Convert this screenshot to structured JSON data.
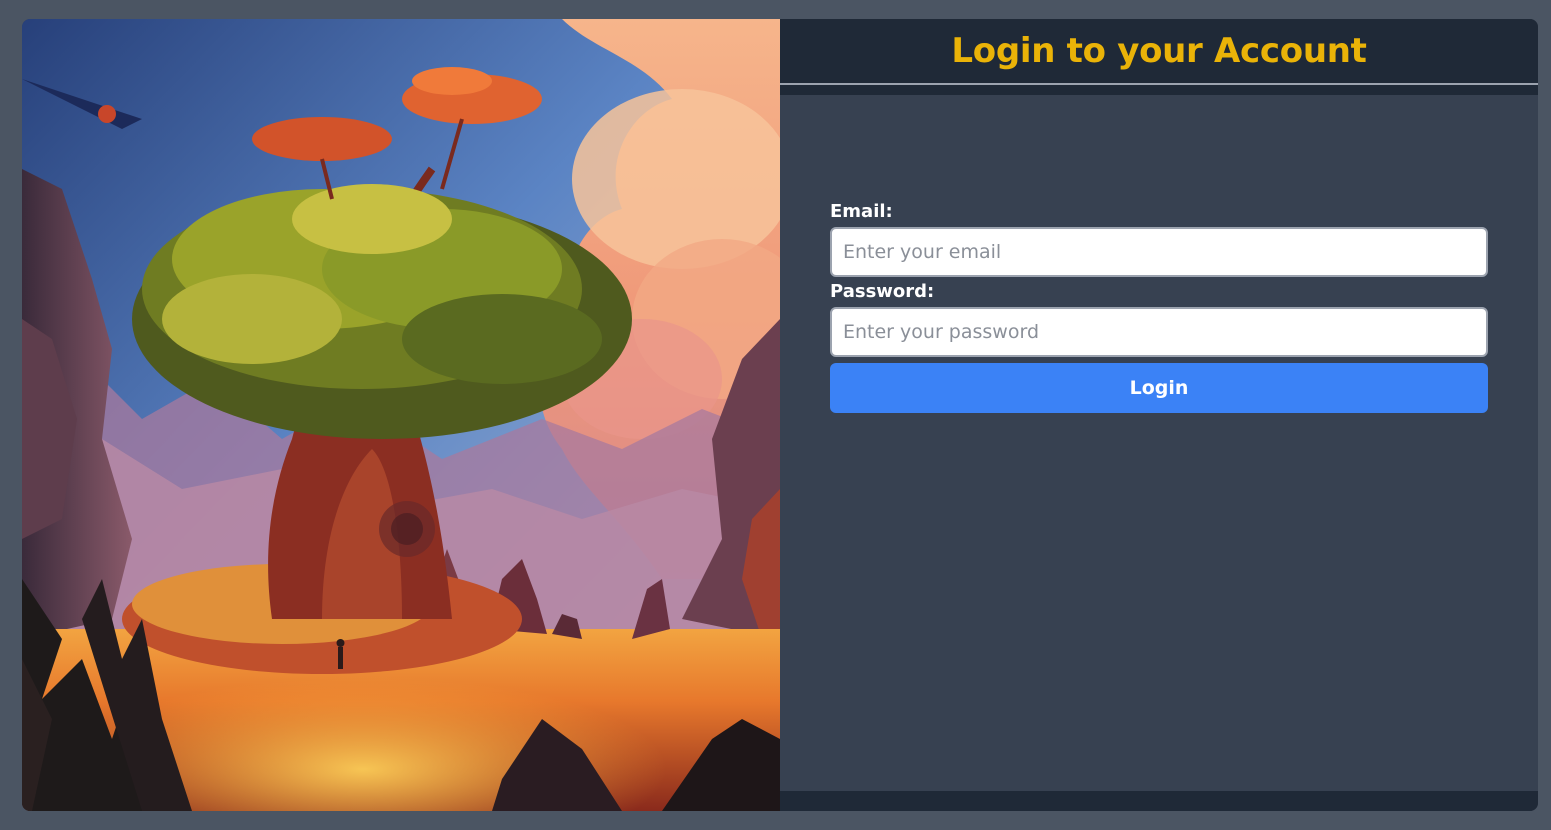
{
  "login": {
    "title": "Login to your Account",
    "email_label": "Email:",
    "email_placeholder": "Enter your email",
    "email_value": "",
    "password_label": "Password:",
    "password_placeholder": "Enter your password",
    "password_value": "",
    "submit_label": "Login"
  },
  "colors": {
    "page_background": "#4b5563",
    "panel_background": "#374151",
    "header_background": "#1f2937",
    "title_color": "#eab308",
    "button_color": "#3b82f6"
  },
  "illustration": {
    "subject": "fantasy-landscape-giant-tree-illustration"
  }
}
